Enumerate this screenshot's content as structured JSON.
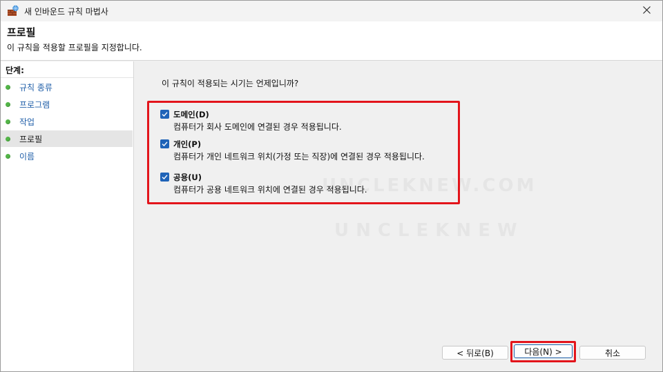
{
  "window": {
    "title": "새 인바운드 규칙 마법사",
    "close_icon": "close-icon"
  },
  "header": {
    "title": "프로필",
    "description": "이 규칙을 적용할 프로필을 지정합니다."
  },
  "sidebar": {
    "label": "단계:",
    "items": [
      {
        "label": "규칙 종류",
        "active": false
      },
      {
        "label": "프로그램",
        "active": false
      },
      {
        "label": "작업",
        "active": false
      },
      {
        "label": "프로필",
        "active": true
      },
      {
        "label": "이름",
        "active": false
      }
    ]
  },
  "content": {
    "question": "이 규칙이 적용되는 시기는 언제입니까?",
    "options": [
      {
        "label": "도메인(D)",
        "description": "컴퓨터가 회사 도메인에 연결된 경우 적용됩니다.",
        "checked": true
      },
      {
        "label": "개인(P)",
        "description": "컴퓨터가 개인 네트워크 위치(가정 또는 직장)에 연결된 경우 적용됩니다.",
        "checked": true
      },
      {
        "label": "공용(U)",
        "description": "컴퓨터가 공용 네트워크 위치에 연결된 경우 적용됩니다.",
        "checked": true
      }
    ],
    "watermark_1": "UNCLEKNEW.COM",
    "watermark_2": "UNCLEKNEW"
  },
  "buttons": {
    "back": "< 뒤로(B)",
    "next": "다음(N) >",
    "cancel": "취소"
  },
  "colors": {
    "accent": "#1f63b8",
    "highlight": "#e3141b",
    "step_dot": "#53b548",
    "link": "#1f5ea8"
  }
}
